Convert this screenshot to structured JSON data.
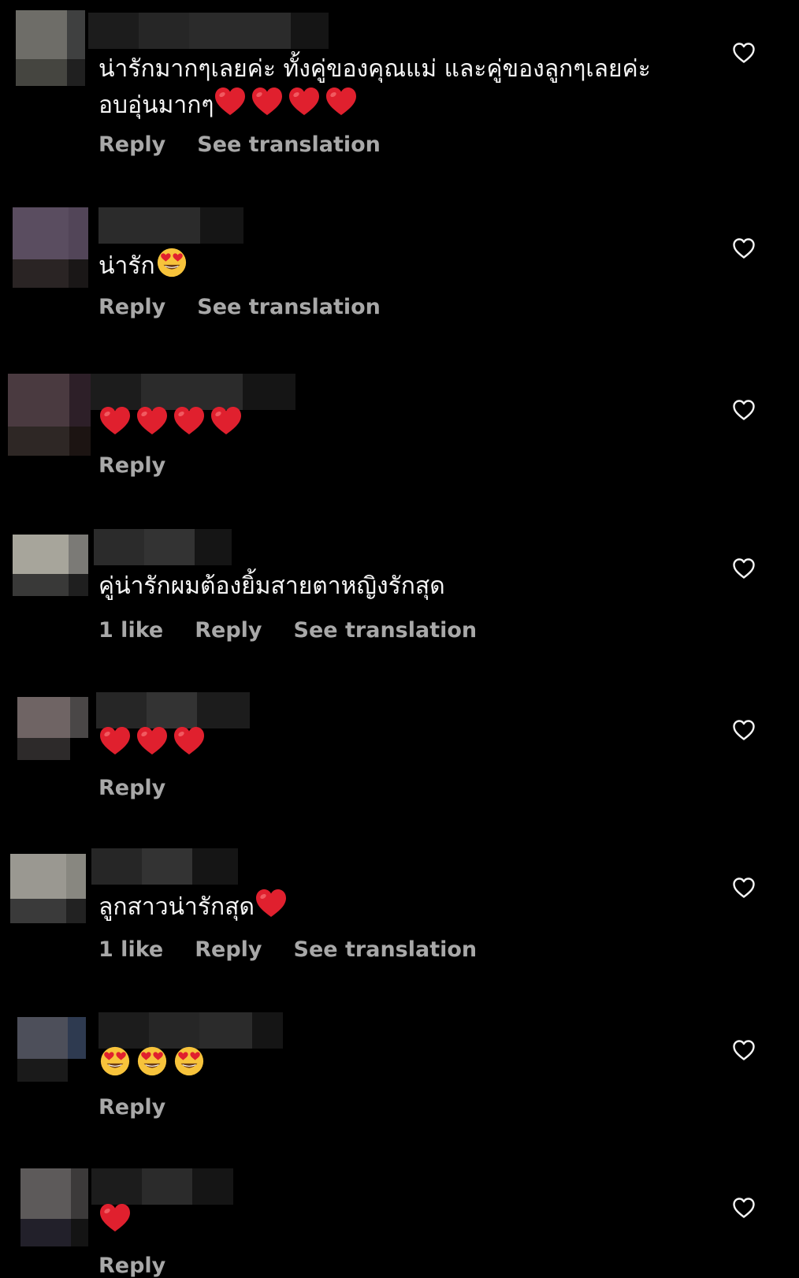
{
  "comments": [
    {
      "username_hidden": true,
      "text": "น่ารักมากๆเลยค่ะ ทั้งคู่ของคุณแม่ และคู่ของลูกๆเลยค่ะ อบอุ่นมากๆ",
      "emojis": [
        "red-heart",
        "red-heart",
        "red-heart",
        "red-heart"
      ],
      "likes_label": "",
      "reply_label": "Reply",
      "translation_label": "See translation"
    },
    {
      "username_hidden": true,
      "text": "น่ารัก",
      "emojis": [
        "heart-eyes"
      ],
      "likes_label": "",
      "reply_label": "Reply",
      "translation_label": "See translation"
    },
    {
      "username_hidden": true,
      "text": "",
      "emojis": [
        "red-heart",
        "red-heart",
        "red-heart",
        "red-heart"
      ],
      "likes_label": "",
      "reply_label": "Reply",
      "translation_label": ""
    },
    {
      "username_hidden": true,
      "text": "คู่น่ารักผมต้องยิ้มสายตาหญิงรักสุด",
      "emojis": [],
      "likes_label": "1 like",
      "reply_label": "Reply",
      "translation_label": "See translation"
    },
    {
      "username_hidden": true,
      "text": "",
      "emojis": [
        "red-heart",
        "red-heart",
        "red-heart"
      ],
      "likes_label": "",
      "reply_label": "Reply",
      "translation_label": ""
    },
    {
      "username_hidden": true,
      "text": "ลูกสาวน่ารักสุด",
      "emojis": [
        "red-heart"
      ],
      "likes_label": "1 like",
      "reply_label": "Reply",
      "translation_label": "See translation"
    },
    {
      "username_hidden": true,
      "text": "",
      "emojis": [
        "heart-eyes",
        "heart-eyes",
        "heart-eyes"
      ],
      "likes_label": "",
      "reply_label": "Reply",
      "translation_label": ""
    },
    {
      "username_hidden": true,
      "text": "",
      "emojis": [
        "red-heart"
      ],
      "likes_label": "",
      "reply_label": "Reply",
      "translation_label": ""
    }
  ],
  "icons": {
    "like": "heart-outline-icon"
  },
  "colors": {
    "background": "#000000",
    "text": "#f5f5f5",
    "meta": "#a8a8a8",
    "heart_emoji": "#e0202e",
    "emoji_face": "#f7c33b"
  }
}
